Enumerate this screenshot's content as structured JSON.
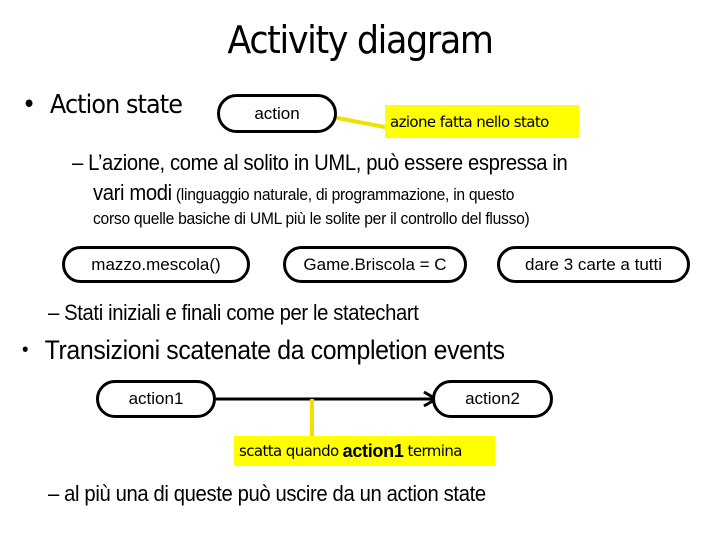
{
  "title": "Activity diagram",
  "section1": {
    "bullet": "•",
    "label": "Action state",
    "action_node": "action",
    "action_note": "azione fatta nello stato",
    "sub1": {
      "dash": "–",
      "line1": "L’azione, come al solito in UML, può  essere espressa in",
      "line2_big": "vari modi",
      "line2_small": " (linguaggio naturale, di programmazione, in questo",
      "line3": "corso quelle basiche di UML più le solite per il controllo del flusso)"
    },
    "examples": [
      "mazzo.mescola()",
      "Game.Briscola = C",
      "dare 3 carte a tutti"
    ],
    "sub2": {
      "dash": "–",
      "text": "Stati iniziali e finali come per le statechart"
    }
  },
  "section2": {
    "bullet": "•",
    "label": "Transizioni scatenate da completion events",
    "source_node": "action1",
    "target_node": "action2",
    "note": {
      "before": "scatta quando",
      "highlight": "action1",
      "after": "termina"
    },
    "sub": {
      "dash": "–",
      "text": "al più una di queste può uscire da un action state"
    }
  },
  "colors": {
    "note_background": "#ffff00",
    "connector": "#f0e000",
    "stroke": "#000000"
  }
}
